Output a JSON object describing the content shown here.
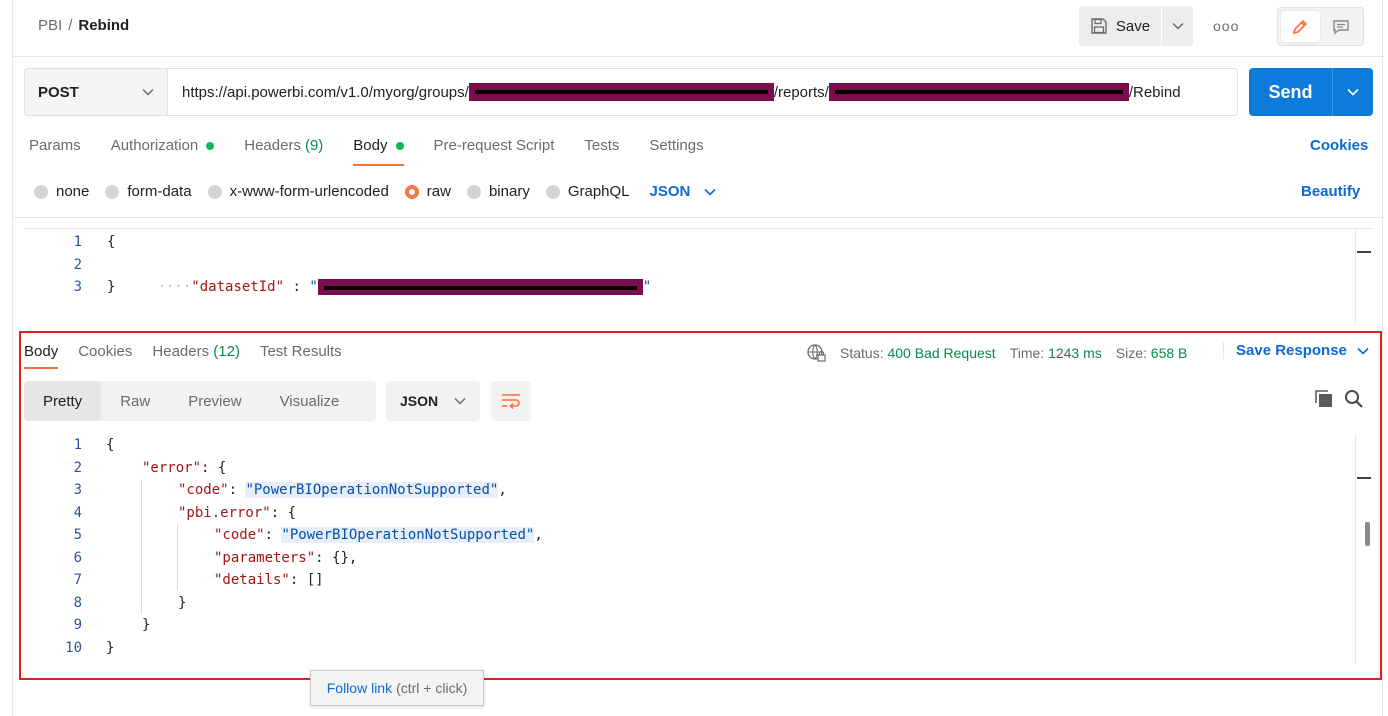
{
  "breadcrumb": {
    "collection": "PBI",
    "separator": "/",
    "request": "Rebind"
  },
  "toolbar": {
    "save_label": "Save",
    "more_label": "ooo"
  },
  "request": {
    "method": "POST",
    "url_prefix": "https://api.powerbi.com/v1.0/myorg/groups/",
    "url_middle": "/reports/",
    "url_suffix": "/Rebind",
    "send_label": "Send"
  },
  "request_tabs": [
    {
      "label": "Params"
    },
    {
      "label": "Authorization"
    },
    {
      "label": "Headers",
      "count": "(9)"
    },
    {
      "label": "Body"
    },
    {
      "label": "Pre-request Script"
    },
    {
      "label": "Tests"
    },
    {
      "label": "Settings"
    }
  ],
  "cookies_label": "Cookies",
  "body_types": [
    "none",
    "form-data",
    "x-www-form-urlencoded",
    "raw",
    "binary",
    "GraphQL"
  ],
  "body_format": "JSON",
  "beautify_label": "Beautify",
  "request_body": {
    "line_numbers": [
      "1",
      "2",
      "3"
    ],
    "open": "{",
    "key": "\"datasetId\"",
    "colon": " : ",
    "quote_open": "\"",
    "quote_close": "\"",
    "close": "}"
  },
  "response_tabs": [
    {
      "label": "Body"
    },
    {
      "label": "Cookies"
    },
    {
      "label": "Headers",
      "count": "(12)"
    },
    {
      "label": "Test Results"
    }
  ],
  "status": {
    "status_label": "Status:",
    "status_value": "400 Bad Request",
    "time_label": "Time:",
    "time_value": "1243 ms",
    "size_label": "Size:",
    "size_value": "658 B"
  },
  "save_response_label": "Save Response",
  "view_tabs": [
    "Pretty",
    "Raw",
    "Preview",
    "Visualize"
  ],
  "response_format": "JSON",
  "response_body": {
    "line_numbers": [
      "1",
      "2",
      "3",
      "4",
      "5",
      "6",
      "7",
      "8",
      "9",
      "10"
    ],
    "lines": [
      {
        "k": "",
        "v": "{"
      },
      {
        "k": "\"error\"",
        "v": ": {"
      },
      {
        "k": "\"code\"",
        "s": "\"PowerBIOperationNotSupported\"",
        "t": ","
      },
      {
        "k": "\"pbi.error\"",
        "v": ": {"
      },
      {
        "k": "\"code\"",
        "s": "\"PowerBIOperationNotSupported\"",
        "t": ","
      },
      {
        "k": "\"parameters\"",
        "v": ": {},"
      },
      {
        "k": "\"details\"",
        "v": ": []"
      },
      {
        "k": "",
        "v": "}"
      },
      {
        "k": "",
        "v": "}"
      },
      {
        "k": "",
        "v": "}"
      }
    ]
  },
  "tooltip": {
    "link": "Follow link",
    "hint": "(ctrl + click)"
  },
  "colors": {
    "accent": "#ff6c37",
    "primary": "#0c7bdc",
    "success": "#0a8a46",
    "highlight_border": "#e02020",
    "redaction": "#7a0d4c"
  }
}
